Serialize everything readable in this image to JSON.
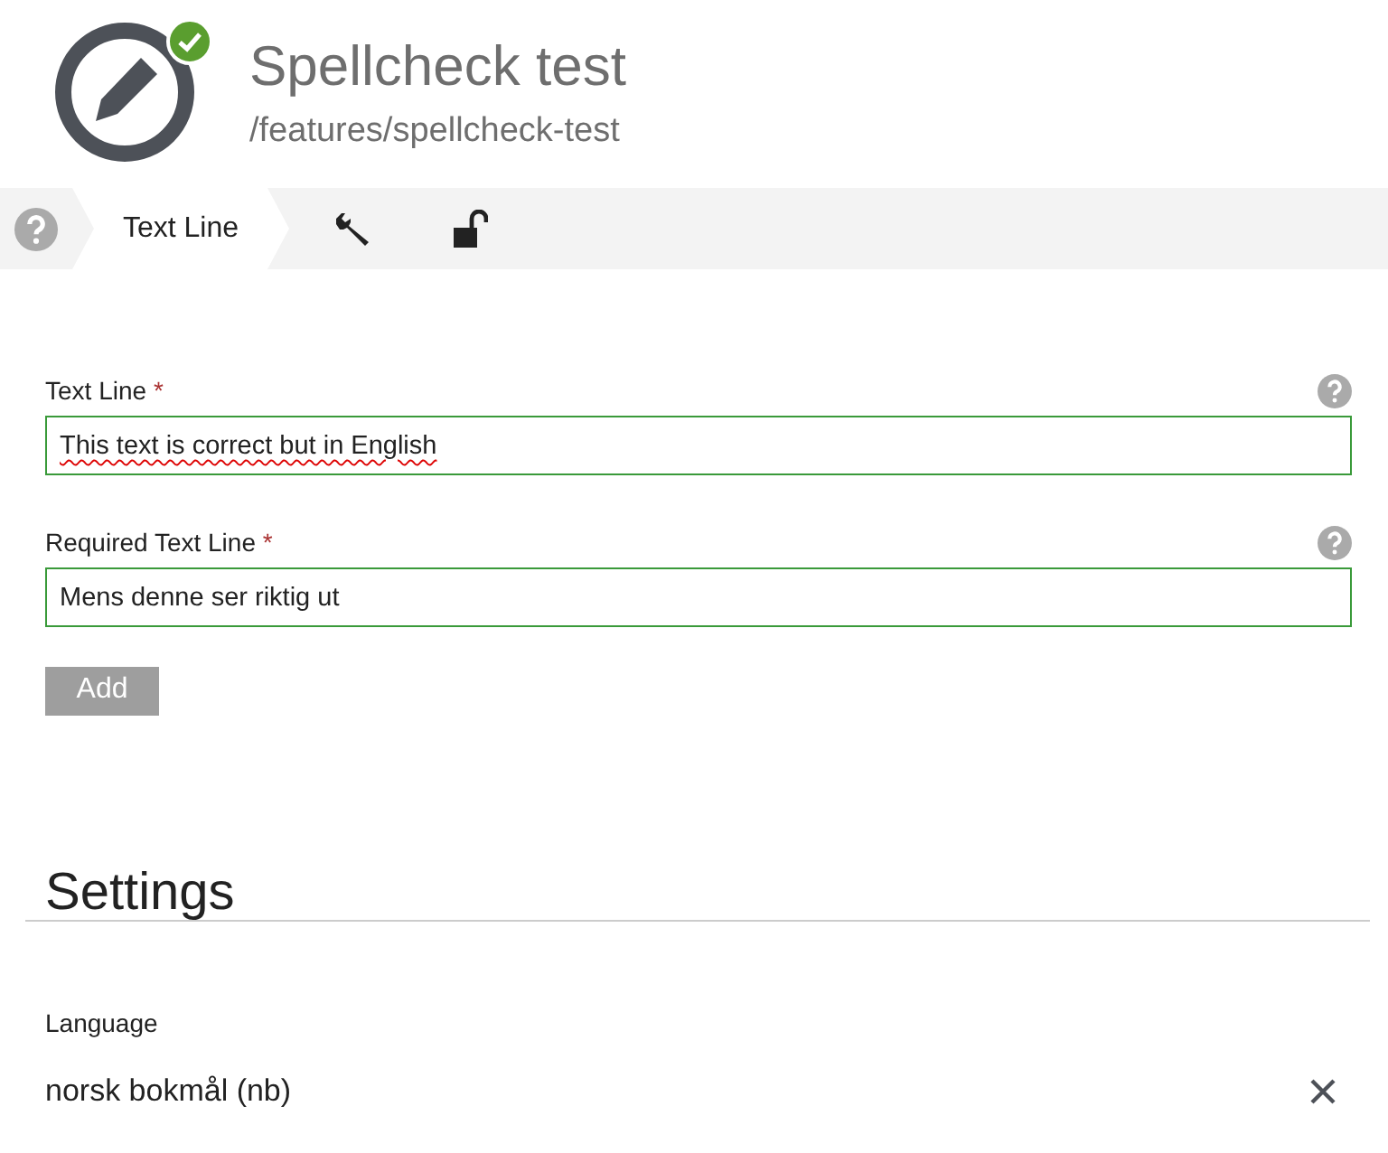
{
  "header": {
    "title": "Spellcheck test",
    "path": "/features/spellcheck-test",
    "valid": true
  },
  "tabs": [
    {
      "kind": "help",
      "selected": false
    },
    {
      "kind": "text",
      "label": "Text Line",
      "selected": true
    },
    {
      "kind": "settings",
      "selected": false
    },
    {
      "kind": "permissions",
      "selected": false
    }
  ],
  "fields": [
    {
      "label": "Text Line",
      "required_mark": "*",
      "value": "This text is correct but in English",
      "misspelled": true
    },
    {
      "label": "Required Text Line",
      "required_mark": "*",
      "value": "Mens denne ser riktig ut",
      "misspelled": false
    }
  ],
  "add_button": "Add",
  "settings": {
    "title": "Settings",
    "language_label": "Language",
    "language_value": "norsk bokmål (nb)"
  }
}
